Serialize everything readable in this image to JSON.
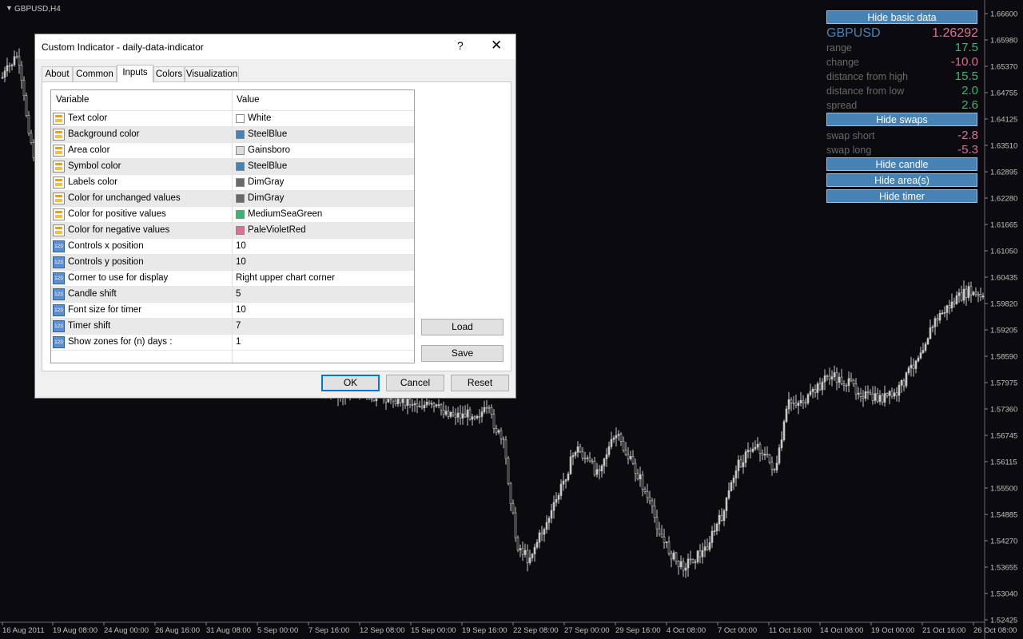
{
  "chart": {
    "symbol_tf": "GBPUSD,H4",
    "price_ticks": [
      "1.66600",
      "1.65980",
      "1.65370",
      "1.64755",
      "1.64125",
      "1.63510",
      "1.62895",
      "1.62280",
      "1.61665",
      "1.61050",
      "1.60435",
      "1.59820",
      "1.59205",
      "1.58590",
      "1.57975",
      "1.57360",
      "1.56745",
      "1.56115",
      "1.55500",
      "1.54885",
      "1.54270",
      "1.53655",
      "1.53040",
      "1.52425"
    ],
    "time_ticks": [
      "16 Aug 2011",
      "19 Aug 08:00",
      "24 Aug 00:00",
      "26 Aug 16:00",
      "31 Aug 08:00",
      "5 Sep 00:00",
      "7 Sep 16:00",
      "12 Sep 08:00",
      "15 Sep 00:00",
      "19 Sep 16:00",
      "22 Sep 08:00",
      "27 Sep 00:00",
      "29 Sep 16:00",
      "4 Oct 08:00",
      "7 Oct 00:00",
      "11 Oct 16:00",
      "14 Oct 08:00",
      "19 Oct 00:00",
      "21 Oct 16:00",
      "26 Oct 08:00"
    ],
    "colors": {
      "background": "#0b0b0f",
      "candle": "#c8c8c8",
      "axis_text": "#c0c0c0"
    }
  },
  "overlay": {
    "hide_basic_data": "Hide basic data",
    "symbol": "GBPUSD",
    "price": "1.26292",
    "rows": [
      {
        "label": "range",
        "value": "17.5",
        "color": "#3cb371"
      },
      {
        "label": "change",
        "value": "-10.0",
        "color": "#db7093"
      },
      {
        "label": "distance from high",
        "value": "15.5",
        "color": "#3cb371"
      },
      {
        "label": "distance from low",
        "value": "2.0",
        "color": "#3cb371"
      },
      {
        "label": "spread",
        "value": "2.6",
        "color": "#3cb371"
      }
    ],
    "hide_swaps": "Hide swaps",
    "swap_rows": [
      {
        "label": "swap short",
        "value": "-2.8",
        "color": "#db7093"
      },
      {
        "label": "swap long",
        "value": "-5.3",
        "color": "#db7093"
      }
    ],
    "hide_candle": "Hide candle",
    "hide_areas": "Hide area(s)",
    "hide_timer": "Hide timer"
  },
  "dialog": {
    "title": "Custom Indicator - daily-data-indicator",
    "help": "?",
    "close": "✕",
    "tabs": [
      "About",
      "Common",
      "Inputs",
      "Colors",
      "Visualization"
    ],
    "active_tab": "Inputs",
    "col_variable": "Variable",
    "col_value": "Value",
    "rows": [
      {
        "name": "Text color",
        "value": "White",
        "swatch": "#ffffff",
        "type": "color"
      },
      {
        "name": "Background color",
        "value": "SteelBlue",
        "swatch": "#4682b4",
        "type": "color"
      },
      {
        "name": "Area color",
        "value": "Gainsboro",
        "swatch": "#dcdcdc",
        "type": "color"
      },
      {
        "name": "Symbol color",
        "value": "SteelBlue",
        "swatch": "#4682b4",
        "type": "color"
      },
      {
        "name": "Labels color",
        "value": "DimGray",
        "swatch": "#696969",
        "type": "color"
      },
      {
        "name": "Color for unchanged values",
        "value": "DimGray",
        "swatch": "#696969",
        "type": "color"
      },
      {
        "name": "Color for positive values",
        "value": "MediumSeaGreen",
        "swatch": "#3cb371",
        "type": "color"
      },
      {
        "name": "Color for negative values",
        "value": "PaleVioletRed",
        "swatch": "#db7093",
        "type": "color"
      },
      {
        "name": "Controls x position",
        "value": "10",
        "type": "number"
      },
      {
        "name": "Controls y position",
        "value": "10",
        "type": "number"
      },
      {
        "name": "Corner to use for display",
        "value": "Right upper chart corner",
        "type": "number"
      },
      {
        "name": "Candle shift",
        "value": "5",
        "type": "number"
      },
      {
        "name": "Font size for timer",
        "value": "10",
        "type": "number"
      },
      {
        "name": "Timer shift",
        "value": "7",
        "type": "number"
      },
      {
        "name": "Show zones for (n) days :",
        "value": "1",
        "type": "number"
      }
    ],
    "load": "Load",
    "save": "Save",
    "ok": "OK",
    "cancel": "Cancel",
    "reset": "Reset"
  }
}
